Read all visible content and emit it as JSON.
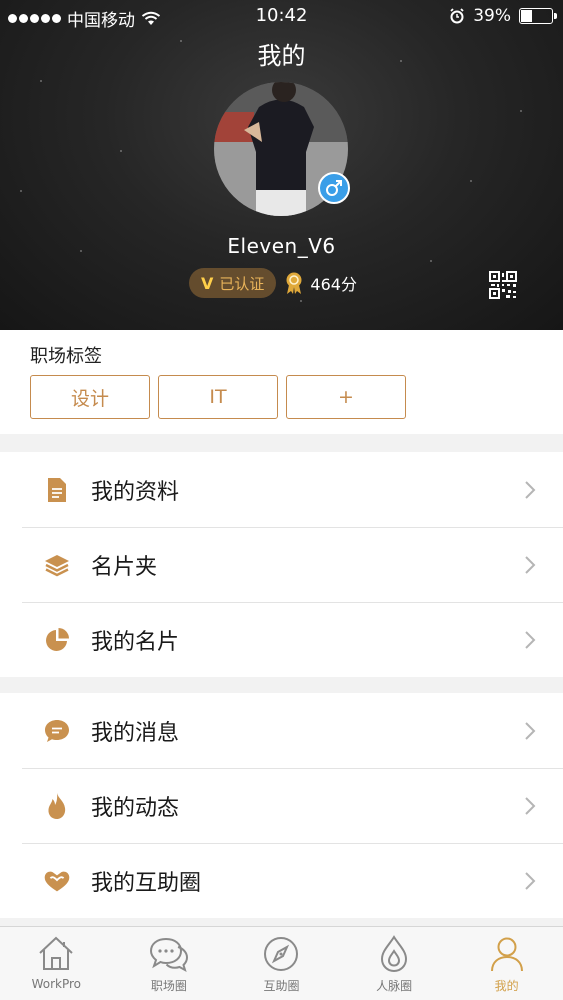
{
  "status_bar": {
    "carrier": "中国移动",
    "time": "10:42",
    "battery_percent": "39%",
    "battery_level": 0.39
  },
  "header": {
    "title": "我的",
    "username": "Eleven_V6",
    "verified_label": "已认证",
    "verified_mark": "V",
    "points": "464分"
  },
  "tags": {
    "title": "职场标签",
    "items": [
      "设计",
      "IT",
      "+"
    ]
  },
  "menu_group_1": [
    {
      "label": "我的资料",
      "icon": "document-icon"
    },
    {
      "label": "名片夹",
      "icon": "layers-icon"
    },
    {
      "label": "我的名片",
      "icon": "pie-icon"
    }
  ],
  "menu_group_2": [
    {
      "label": "我的消息",
      "icon": "chat-bubble-icon"
    },
    {
      "label": "我的动态",
      "icon": "flame-icon"
    },
    {
      "label": "我的互助圈",
      "icon": "heart-hands-icon"
    }
  ],
  "tabbar": [
    {
      "label": "WorkPro",
      "icon": "house-icon",
      "active": false
    },
    {
      "label": "职场圈",
      "icon": "chat-icon",
      "active": false
    },
    {
      "label": "互助圈",
      "icon": "compass-icon",
      "active": false
    },
    {
      "label": "人脉圈",
      "icon": "drop-icon",
      "active": false
    },
    {
      "label": "我的",
      "icon": "person-icon",
      "active": true
    }
  ],
  "colors": {
    "accent": "#c58b4e",
    "tab_active": "#d2a04a",
    "icon_tan": "#c9914f"
  }
}
